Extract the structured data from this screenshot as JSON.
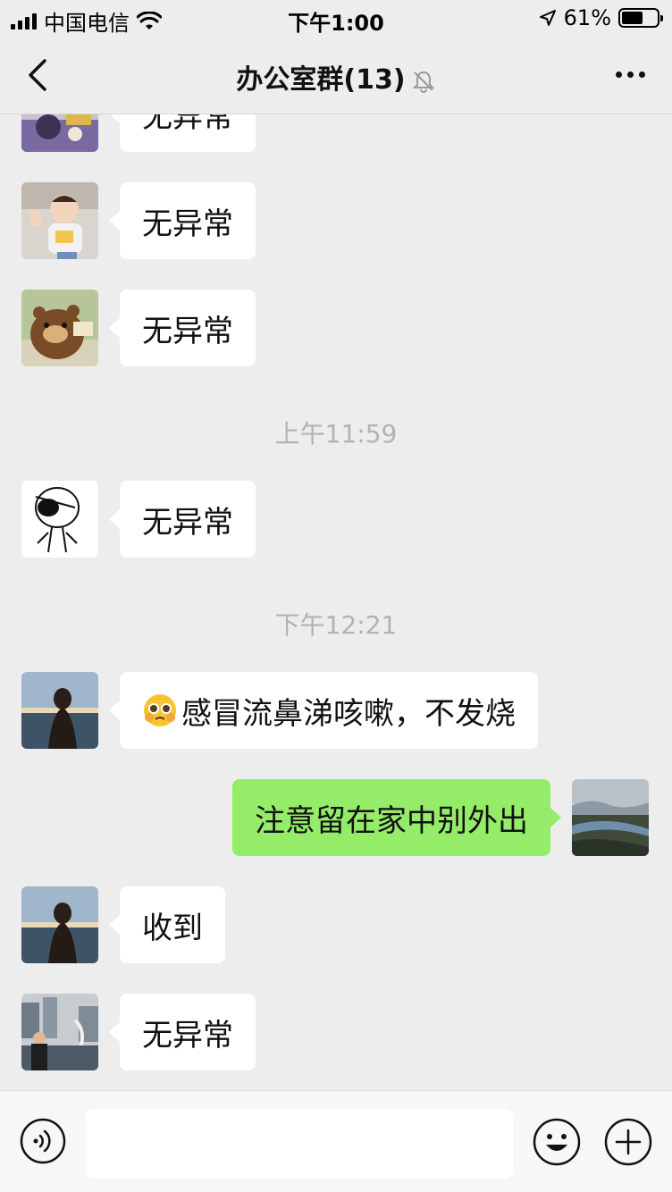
{
  "status_bar": {
    "carrier": "中国电信",
    "time": "下午1:00",
    "battery_text": "61%",
    "battery_level": 0.61
  },
  "nav": {
    "title": "办公室群(13)",
    "muted": true
  },
  "messages": [
    {
      "side": "left",
      "text": "无异常",
      "avatar": "avatar-cartoon-1"
    },
    {
      "side": "left",
      "text": "无异常",
      "avatar": "avatar-child"
    },
    {
      "side": "left",
      "text": "无异常",
      "avatar": "avatar-bear"
    },
    {
      "type": "time",
      "text": "上午11:59"
    },
    {
      "side": "left",
      "text": "无异常",
      "avatar": "avatar-eyepatch"
    },
    {
      "type": "time",
      "text": "下午12:21"
    },
    {
      "side": "left",
      "text": "感冒流鼻涕咳嗽，不发烧",
      "avatar": "avatar-sea-girl",
      "emoji": "pleading-face"
    },
    {
      "side": "right",
      "text": "注意留在家中别外出",
      "avatar": "avatar-landscape"
    },
    {
      "side": "left",
      "text": "收到",
      "avatar": "avatar-sea-girl"
    },
    {
      "side": "left",
      "text": "无异常",
      "avatar": "avatar-merlion"
    }
  ],
  "input_bar": {
    "value": "",
    "icons": [
      "voice-icon",
      "emoji-icon",
      "plus-icon"
    ]
  },
  "colors": {
    "background": "#ededed",
    "outgoing_bubble": "#95ec69",
    "incoming_bubble": "#ffffff",
    "timestamp": "#b2b2b2"
  }
}
